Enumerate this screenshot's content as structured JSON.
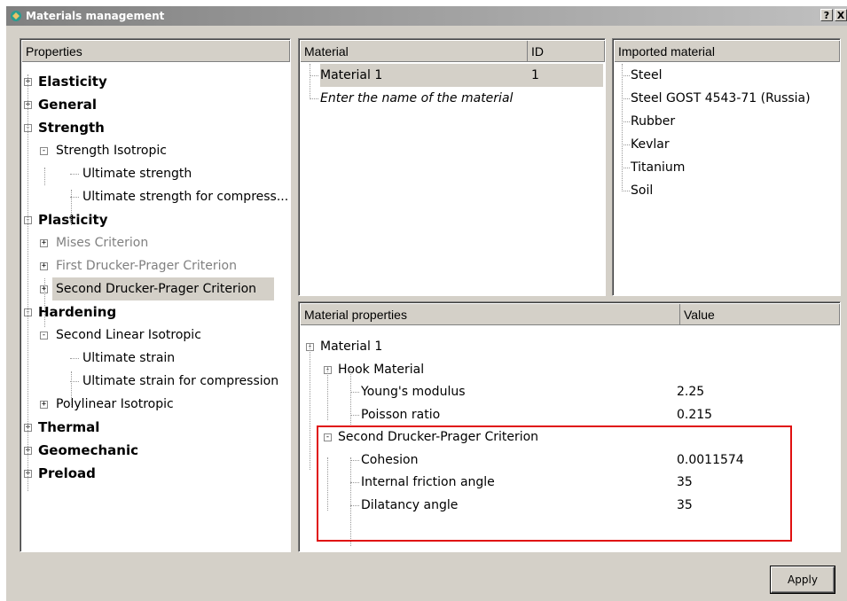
{
  "window": {
    "title": "Materials management",
    "help_btn": "?",
    "close_btn": "X",
    "icon": "app-logo-icon"
  },
  "properties": {
    "header": "Properties",
    "items": [
      {
        "label": "Elasticity",
        "bold": true,
        "expander": "+"
      },
      {
        "label": "General",
        "bold": true,
        "expander": "+"
      },
      {
        "label": "Strength",
        "bold": true,
        "expander": "-"
      },
      {
        "label": "Strength Isotropic",
        "expander": "-"
      },
      {
        "label": "Ultimate strength"
      },
      {
        "label": "Ultimate strength for compress..."
      },
      {
        "label": "Plasticity",
        "bold": true,
        "expander": "-"
      },
      {
        "label": "Mises Criterion",
        "expander": "+",
        "disabled": true
      },
      {
        "label": "First Drucker-Prager Criterion",
        "expander": "+",
        "disabled": true
      },
      {
        "label": "Second Drucker-Prager Criterion",
        "expander": "+",
        "selected": true
      },
      {
        "label": "Hardening",
        "bold": true,
        "expander": "-"
      },
      {
        "label": "Second Linear Isotropic",
        "expander": "-"
      },
      {
        "label": "Ultimate strain"
      },
      {
        "label": "Ultimate strain for compression"
      },
      {
        "label": "Polylinear Isotropic",
        "expander": "+"
      },
      {
        "label": "Thermal",
        "bold": true,
        "expander": "+"
      },
      {
        "label": "Geomechanic",
        "bold": true,
        "expander": "+"
      },
      {
        "label": "Preload",
        "bold": true,
        "expander": "+"
      }
    ]
  },
  "materials": {
    "col_material": "Material",
    "col_id": "ID",
    "rows": [
      {
        "name": "Material 1",
        "id": "1"
      },
      {
        "name": "Enter the name of the material",
        "id": ""
      }
    ]
  },
  "imported": {
    "header": "Imported material",
    "items": [
      "Steel",
      "Steel GOST 4543-71 (Russia)",
      "Rubber",
      "Kevlar",
      "Titanium",
      "Soil"
    ]
  },
  "material_properties": {
    "col_property": "Material properties",
    "col_value": "Value",
    "rows": [
      {
        "label": "Material 1",
        "value": ""
      },
      {
        "label": "Hook Material",
        "value": ""
      },
      {
        "label": "Young's modulus",
        "value": "2.25"
      },
      {
        "label": "Poisson ratio",
        "value": "0.215"
      },
      {
        "label": "Second Drucker-Prager Criterion",
        "value": ""
      },
      {
        "label": "Cohesion",
        "value": "0.0011574"
      },
      {
        "label": "Internal friction angle",
        "value": "35"
      },
      {
        "label": "Dilatancy angle",
        "value": "35"
      }
    ]
  },
  "buttons": {
    "apply": "Apply"
  },
  "colors": {
    "highlight": "#e01010",
    "selected_bg": "#d4d0c8"
  }
}
